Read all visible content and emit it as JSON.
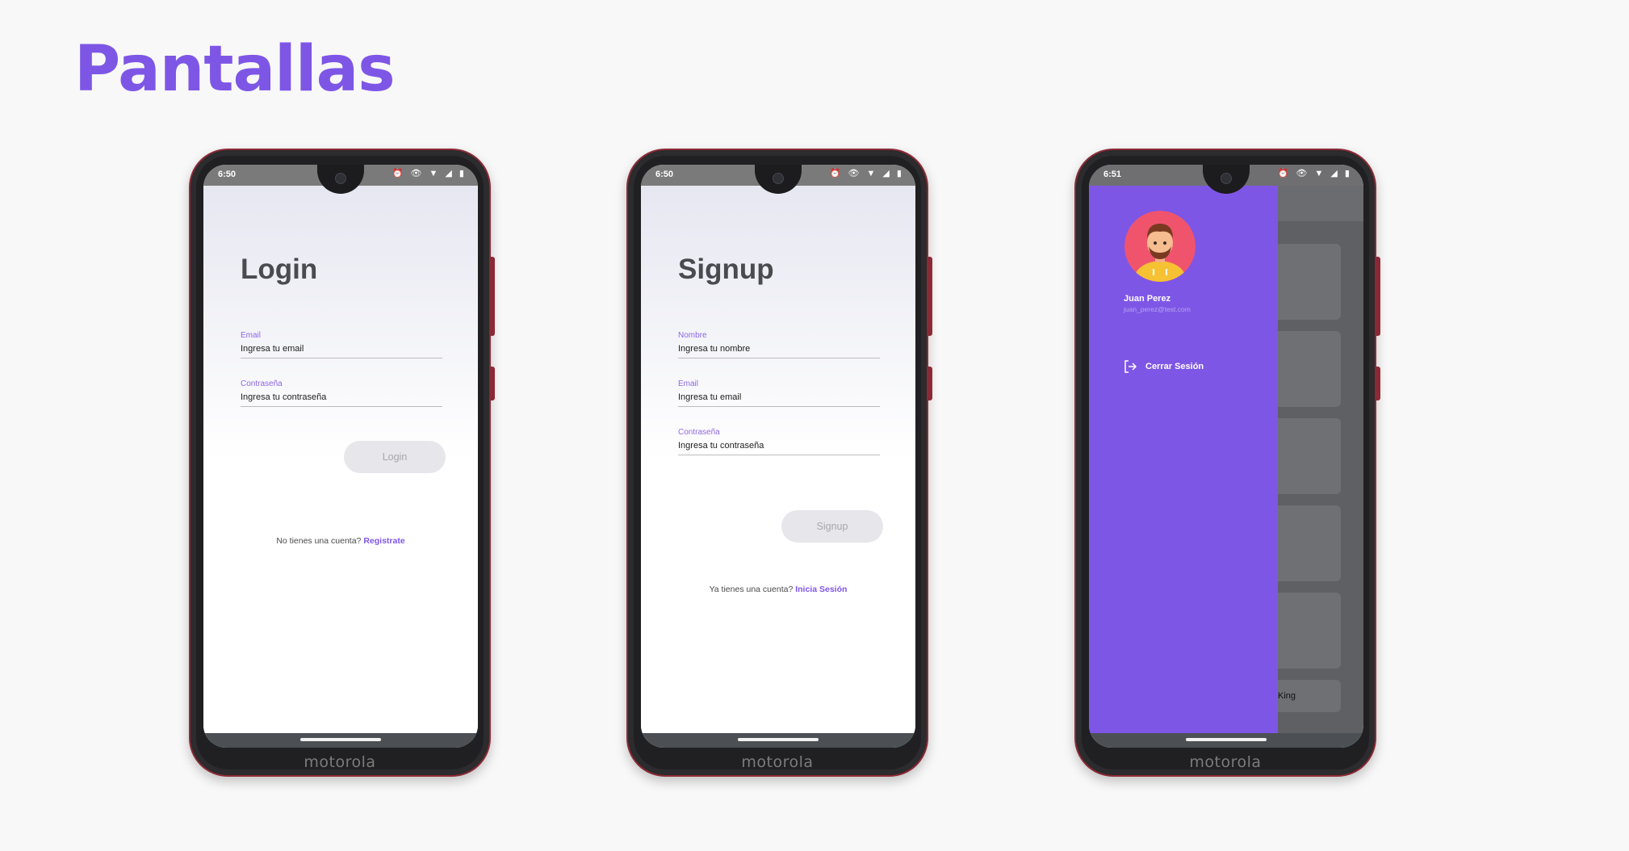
{
  "page": {
    "title": "Pantallas"
  },
  "phones": {
    "brand": "motorola",
    "status_icons": "⏰ 👁 ▼ ◢ ▮"
  },
  "login": {
    "time": "6:50",
    "heading": "Login",
    "email_label": "Email",
    "email_placeholder": "Ingresa tu email",
    "password_label": "Contraseña",
    "password_placeholder": "Ingresa tu contraseña",
    "button_label": "Login",
    "switch_prompt": "No tienes una cuenta?",
    "switch_link": "Registrate"
  },
  "signup": {
    "time": "6:50",
    "heading": "Signup",
    "name_label": "Nombre",
    "name_placeholder": "Ingresa tu nombre",
    "email_label": "Email",
    "email_placeholder": "Ingresa tu email",
    "password_label": "Contraseña",
    "password_placeholder": "Ingresa tu contraseña",
    "button_label": "Signup",
    "switch_prompt": "Ya tienes una cuenta?",
    "switch_link": "Inicia Sesión"
  },
  "drawer_screen": {
    "time": "6:51",
    "user_name": "Juan Perez",
    "user_email": "juan_perez@test.com",
    "logout_label": "Cerrar Sesión",
    "background_card_text": "King"
  },
  "colors": {
    "accent": "#7e56e6",
    "background": "#f8f8f8",
    "phone_frame": "#202022",
    "phone_trim": "#8b2a36"
  },
  "icons": [
    "camera-icon",
    "alarm-icon",
    "eye-icon",
    "wifi-icon",
    "signal-icon",
    "battery-icon",
    "logout-icon",
    "avatar-icon"
  ]
}
